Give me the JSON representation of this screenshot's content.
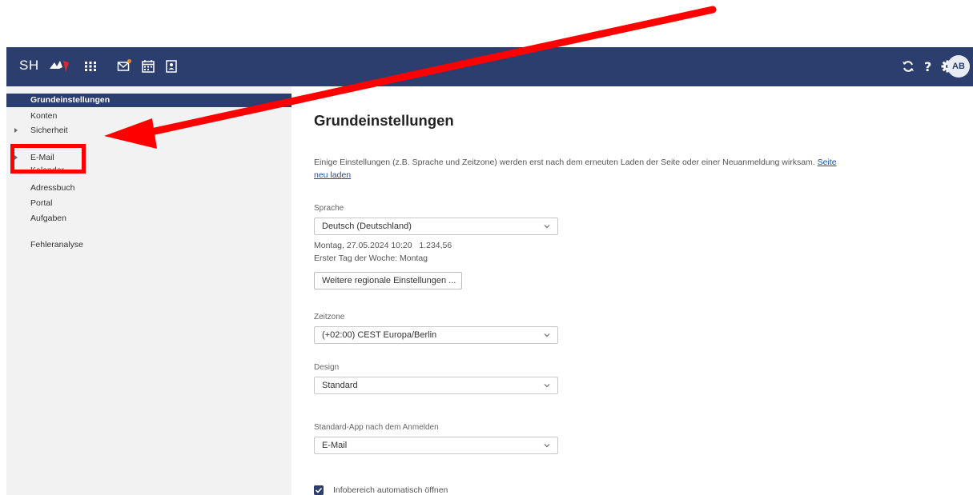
{
  "header": {
    "brand": "SH",
    "avatar_initials": "AB",
    "accent_color": "#2c3e6e",
    "icons": [
      "apps-grid-icon",
      "mail-icon",
      "calendar-icon",
      "contacts-icon",
      "refresh-icon",
      "help-icon",
      "gear-icon"
    ]
  },
  "sidebar": {
    "active": "Grundeinstellungen",
    "items": [
      {
        "label": "Konten"
      },
      {
        "label": "Sicherheit",
        "expandable": true
      },
      {
        "label": "E-Mail",
        "expandable": true
      },
      {
        "label": "Kalender"
      },
      {
        "label": "Adressbuch"
      },
      {
        "label": "Portal"
      },
      {
        "label": "Aufgaben"
      },
      {
        "label": "Fehleranalyse"
      }
    ]
  },
  "main": {
    "title": "Grundeinstellungen",
    "info_text": "Einige Einstellungen (z.B. Sprache und Zeitzone) werden erst nach dem erneuten Laden der Seite oder einer Neuanmeldung wirksam.",
    "reload_link": "Seite neu laden",
    "language": {
      "label": "Sprache",
      "value": "Deutsch (Deutschland)"
    },
    "locale_sample": "Montag, 27.05.2024 10:20   1.234,56",
    "first_day": "Erster Tag der Woche: Montag",
    "regional_button": "Weitere regionale Einstellungen ...",
    "timezone": {
      "label": "Zeitzone",
      "value": "(+02:00) CEST Europa/Berlin"
    },
    "design": {
      "label": "Design",
      "value": "Standard"
    },
    "default_app": {
      "label": "Standard-App nach dem Anmelden",
      "value": "E-Mail"
    },
    "infobereich_label": "Infobereich automatisch öffnen"
  },
  "annotation": {
    "color": "#ff0000"
  }
}
